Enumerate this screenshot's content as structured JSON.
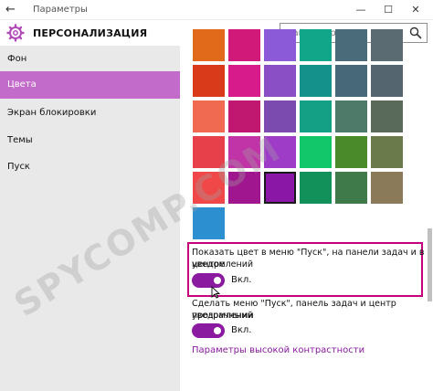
{
  "window": {
    "title": "Параметры",
    "back_icon": "back-arrow-icon",
    "minimize_glyph": "—",
    "maximize_glyph": "☐",
    "close_glyph": "✕"
  },
  "header": {
    "section_title": "ПЕРСОНАЛИЗАЦИЯ",
    "icon": "gear-icon"
  },
  "search": {
    "placeholder": "Найти параметр",
    "icon": "search-icon"
  },
  "sidebar": {
    "items": [
      {
        "label": "Фон"
      },
      {
        "label": "Цвета",
        "active": true
      },
      {
        "label": "Экран блокировки"
      },
      {
        "label": "Темы"
      },
      {
        "label": "Пуск"
      }
    ],
    "active_color": "#c36bca"
  },
  "swatches": [
    "#e06a1a",
    "#d1197a",
    "#8a5ad9",
    "#11a68a",
    "#4a6b7a",
    "#5a6b72",
    "#d93a1a",
    "#d81b8a",
    "#8a4ec5",
    "#14918a",
    "#476879",
    "#546570",
    "#ef6a50",
    "#c01870",
    "#7b4bb0",
    "#14a084",
    "#4e7a6a",
    "#5a6a5a",
    "#e8404a",
    "#c034a8",
    "#9e3cc8",
    "#12c66a",
    "#4a8a2a",
    "#6a7a4a",
    "#f04848",
    "#a0168e",
    "#8b17a6",
    "#12925a",
    "#3f7a4a",
    "#8a7a5a",
    "#2b8fd0"
  ],
  "selected_swatch_index": 26,
  "settings": {
    "show_color": {
      "label_line1": "Показать цвет в меню \"Пуск\", на панели задач и в центре",
      "label_line2": "уведомлений",
      "state": "Вкл."
    },
    "transparency": {
      "label_line1": "Сделать меню \"Пуск\", панель задач и центр уведомлений",
      "label_line2": "прозрачными",
      "state": "Вкл."
    },
    "accent_color": "#8a1aa0",
    "highlight_color": "#c4007a"
  },
  "high_contrast_link": "Параметры высокой контрастности",
  "watermark": "SPYCOMP.COM"
}
